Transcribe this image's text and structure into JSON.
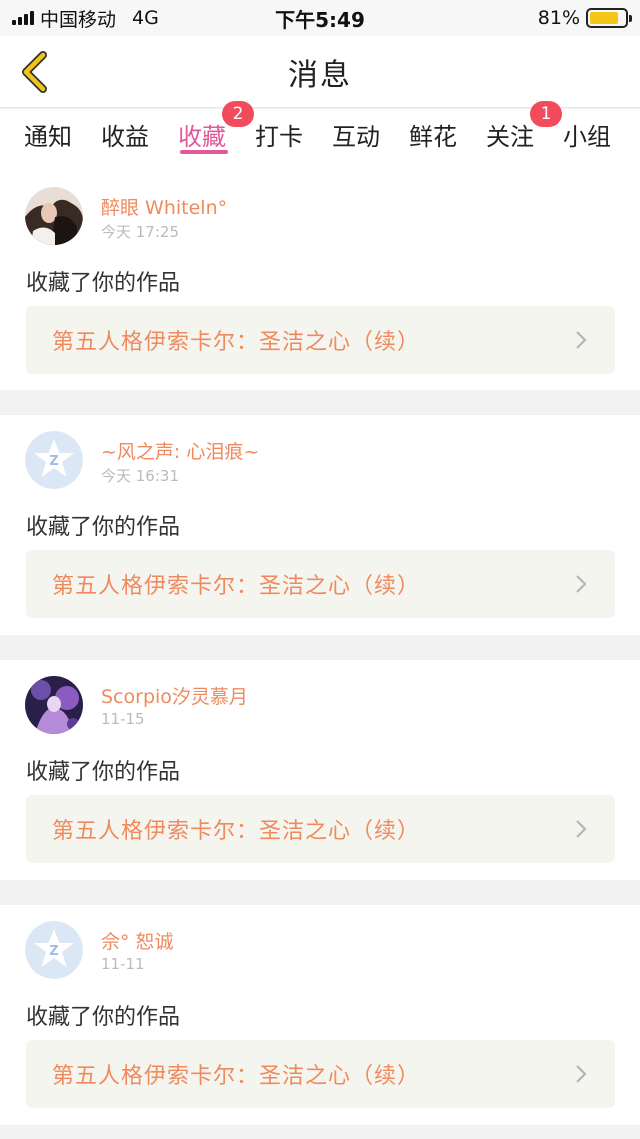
{
  "status": {
    "carrier": "中国移动",
    "network": "4G",
    "time": "下午5:49",
    "battery": "81%",
    "battery_level": 0.81
  },
  "nav": {
    "title": "消息",
    "back_icon": "chevron-left-icon",
    "accent": "#f0c419"
  },
  "tabs": [
    {
      "label": "通知"
    },
    {
      "label": "收益"
    },
    {
      "label": "收藏",
      "badge": "2",
      "active": true
    },
    {
      "label": "打卡"
    },
    {
      "label": "互动"
    },
    {
      "label": "鲜花"
    },
    {
      "label": "关注",
      "badge": "1"
    },
    {
      "label": "小组"
    }
  ],
  "colors": {
    "active_tab": "#e05a99",
    "badge": "#f24b5c",
    "name": "#f08a5e"
  },
  "feed": [
    {
      "user": "醉眼 Whiteln°",
      "time": "今天 17:25",
      "action": "收藏了你的作品",
      "work": "第五人格伊索卡尔：圣洁之心（续）",
      "avatar": "photo-dark"
    },
    {
      "user": "~风之声: 心泪痕~",
      "time": "今天 16:31",
      "action": "收藏了你的作品",
      "work": "第五人格伊索卡尔：圣洁之心（续）",
      "avatar": "default-star"
    },
    {
      "user": "Scorpio汐灵慕月",
      "time": "11-15",
      "action": "收藏了你的作品",
      "work": "第五人格伊索卡尔：圣洁之心（续）",
      "avatar": "photo-purple"
    },
    {
      "user": "佘° 恕诚",
      "time": "11-11",
      "action": "收藏了你的作品",
      "work": "第五人格伊索卡尔：圣洁之心（续）",
      "avatar": "default-star"
    }
  ]
}
